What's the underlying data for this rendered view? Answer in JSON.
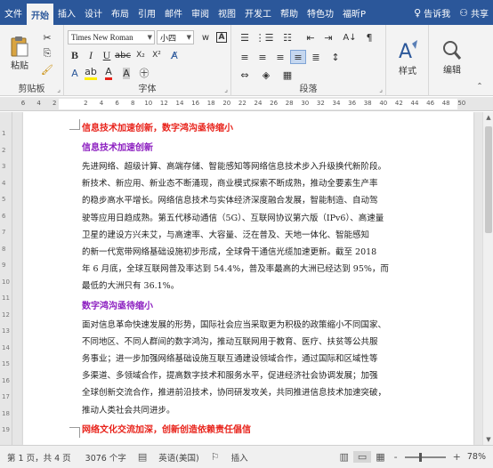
{
  "tabs": [
    {
      "label": "文件"
    },
    {
      "label": "开始"
    },
    {
      "label": "插入"
    },
    {
      "label": "设计"
    },
    {
      "label": "布局"
    },
    {
      "label": "引用"
    },
    {
      "label": "邮件"
    },
    {
      "label": "审阅"
    },
    {
      "label": "视图"
    },
    {
      "label": "开发工"
    },
    {
      "label": "帮助"
    },
    {
      "label": "特色功"
    },
    {
      "label": "福昕P"
    }
  ],
  "active_tab": "开始",
  "tell_me": "告诉我",
  "share": "共享",
  "ribbon": {
    "clipboard": {
      "paste_label": "粘贴",
      "group_label": "剪贴板"
    },
    "font": {
      "font_name": "Times New Roman",
      "font_size": "小四",
      "wen_glyph": "wén",
      "group_label": "字体"
    },
    "paragraph": {
      "group_label": "段落"
    },
    "styles": {
      "label": "样式"
    },
    "editing": {
      "label": "编辑"
    }
  },
  "ruler_numbers": [
    "6",
    "4",
    "2",
    "",
    "2",
    "4",
    "6",
    "8",
    "10",
    "12",
    "14",
    "16",
    "18",
    "20",
    "22",
    "24",
    "26",
    "28",
    "30",
    "32",
    "34",
    "36",
    "38",
    "40",
    "42",
    "44",
    "46",
    "48",
    "50"
  ],
  "vruler_numbers": [
    "1",
    "2",
    "3",
    "4",
    "5",
    "6",
    "7",
    "8",
    "9",
    "10",
    "11",
    "12",
    "13",
    "14",
    "15",
    "16",
    "17",
    "18",
    "19"
  ],
  "document": {
    "heading1": "信息技术加速创新，数字鸿沟亟待缩小",
    "subheading1": "信息技术加速创新",
    "para1_lines": [
      "先进网络、超级计算、高端存储、智能感知等网络信息技术步入升级换代新阶段。",
      "新技术、新应用、新业态不断涌现，商业模式探索不断成熟，推动全要素生产率",
      "的稳步高水平增长。网络信息技术与实体经济深度融合发展，智能制造、自动驾",
      "驶等应用日趋成熟。第五代移动通信（5G）、互联网协议第六版（IPv6）、高速量",
      "卫星的建设方兴未艾，与高速率、大容量、泛在普及、天地一体化、智能感知",
      "的新一代宽带网络基础设施初步形成，全球骨干通信光缆加速更新。截至 2018",
      "年 6 月底，全球互联网普及率达到 54.4%，普及率最高的大洲已经达到 95%，而",
      "最低的大洲只有 36.1%。"
    ],
    "subheading2": "数字鸿沟亟待缩小",
    "para2_lines": [
      "面对信息革命快速发展的形势，国际社会应当采取更为积极的政策缩小不同国家、",
      "不同地区、不同人群间的数字鸿沟，推动互联网用于教育、医疗、扶贫等公共服",
      "务事业；进一步加强网络基础设施互联互通建设领域合作，通过国际和区域性等",
      "多渠道、多领域合作，提高数字技术和服务水平，促进经济社会协调发展；加强",
      "全球创新交流合作，推进前沿技术，协同研发攻关，共同推进信息技术加速突破，",
      "推动人类社会共同进步。"
    ],
    "heading2": "网络文化交流加深，创新创造依赖责任倡信"
  },
  "status": {
    "page": "第 1 页，共 4 页",
    "words": "3076 个字",
    "language": "英语(美国)",
    "mode": "插入",
    "zoom_minus": "-",
    "zoom_plus": "+",
    "zoom": "78%",
    "zoom_fraction": 0.39
  },
  "colors": {
    "ribbon_blue": "#2b579a",
    "heading_red": "#e8221a",
    "heading_purple": "#8c1ec0"
  },
  "icons": [
    "document-icon",
    "accessibility-icon",
    "read-mode-icon",
    "print-layout-icon",
    "web-layout-icon",
    "search-icon",
    "person-icon"
  ]
}
